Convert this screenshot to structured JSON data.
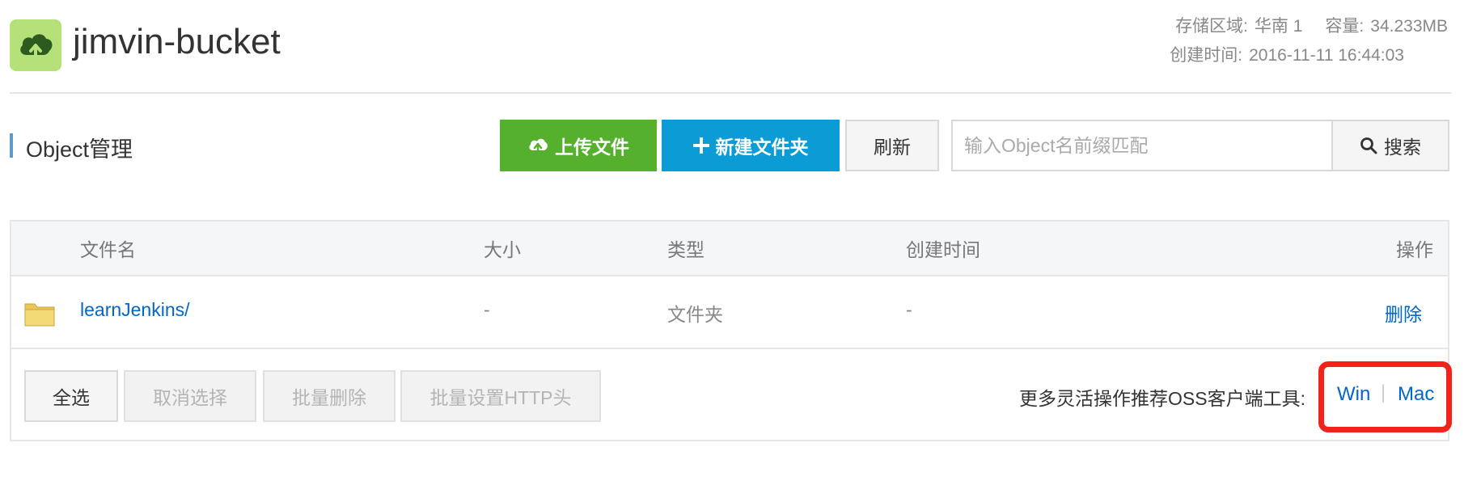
{
  "header": {
    "bucket_name": "jimvin-bucket",
    "region_label": "存储区域:",
    "region_value": "华南 1",
    "capacity_label": "容量:",
    "capacity_value": "34.233MB",
    "created_label": "创建时间:",
    "created_value": "2016-11-11 16:44:03",
    "icon": "cloud-upload-icon",
    "icon_bg_color": "#b6e07a"
  },
  "section": {
    "title": "Object管理",
    "accent_color": "#5c9bd1"
  },
  "toolbar": {
    "upload_label": "上传文件",
    "upload_color": "#55b02d",
    "new_folder_label": "新建文件夹",
    "new_folder_color": "#0b9bd5",
    "refresh_label": "刷新",
    "search_placeholder": "输入Object名前缀匹配",
    "search_value": "",
    "search_label": "搜索"
  },
  "table": {
    "columns": [
      "文件名",
      "大小",
      "类型",
      "创建时间",
      "操作"
    ],
    "rows": [
      {
        "name": "learnJenkins/",
        "size": "-",
        "type": "文件夹",
        "created": "-",
        "action": "删除",
        "icon": "folder-icon"
      }
    ]
  },
  "footer": {
    "select_all": "全选",
    "deselect": "取消选择",
    "batch_delete": "批量删除",
    "batch_http_headers": "批量设置HTTP头",
    "tools_text": "更多灵活操作推荐OSS客户端工具:",
    "win_label": "Win",
    "separator": "|",
    "mac_label": "Mac",
    "highlight_color": "#f0241b"
  }
}
